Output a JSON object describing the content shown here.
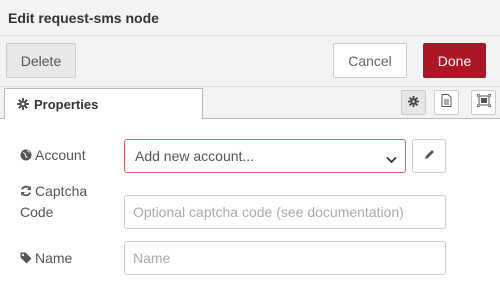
{
  "header": {
    "title": "Edit request-sms node"
  },
  "toolbar": {
    "delete_label": "Delete",
    "cancel_label": "Cancel",
    "done_label": "Done"
  },
  "tabs": {
    "properties_label": "Properties",
    "icons": [
      "gear-icon",
      "description-icon",
      "appearance-icon"
    ]
  },
  "form": {
    "account": {
      "label": "Account",
      "icon": "globe-icon",
      "selected": "Add new account..."
    },
    "captcha": {
      "label_line1": "Captcha",
      "label_line2": "Code",
      "icon": "refresh-icon",
      "placeholder": "Optional captcha code (see documentation)",
      "value": ""
    },
    "name": {
      "label": "Name",
      "icon": "tag-icon",
      "placeholder": "Name",
      "value": ""
    }
  },
  "colors": {
    "done": "#ad1625",
    "invalid_border": "#d6615f",
    "header_bg": "#f3f3f3"
  }
}
